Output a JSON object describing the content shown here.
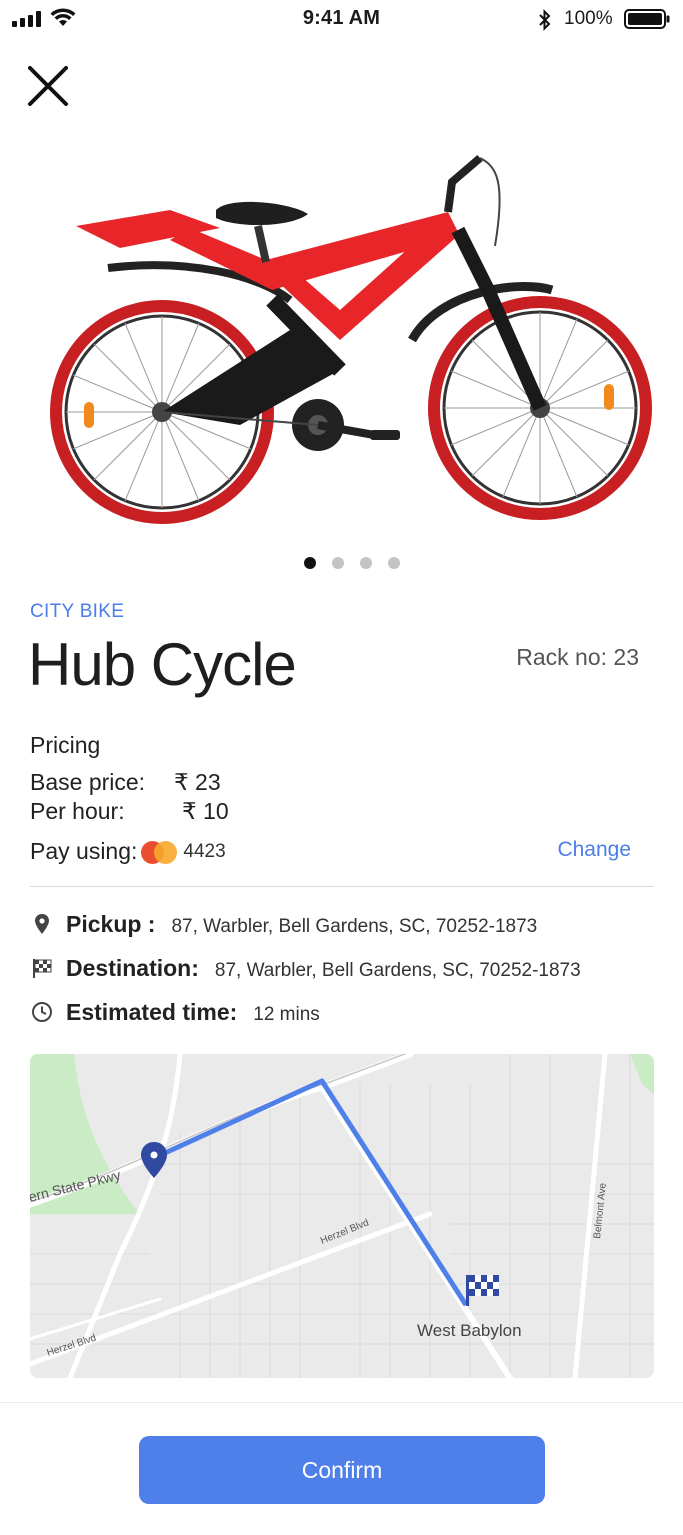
{
  "status_bar": {
    "time": "9:41 AM",
    "battery": "100%"
  },
  "gallery": {
    "active_index": 0,
    "count": 4
  },
  "bike": {
    "category": "CITY BIKE",
    "name": "Hub Cycle",
    "rack": "Rack no: 23"
  },
  "pricing": {
    "heading": "Pricing",
    "base_label": "Base price:",
    "base_value": "₹ 23",
    "hour_label": "Per hour:",
    "hour_value": "₹ 10",
    "pay_label": "Pay using:",
    "card_last4": "4423",
    "change_label": "Change"
  },
  "trip": {
    "pickup_label": "Pickup :",
    "pickup_value": "87, Warbler, Bell Gardens, SC, 70252-1873",
    "destination_label": "Destination:",
    "destination_value": "87, Warbler, Bell Gardens, SC, 70252-1873",
    "time_label": "Estimated time:",
    "time_value": "12 mins"
  },
  "map": {
    "labels": {
      "street1": "ern State Pkwy",
      "street2": "Herzel Blvd",
      "street3": "Herzel Blvd",
      "street4": "Belmont Ave",
      "place": "West Babylon"
    },
    "route_color": "#4f7fe8",
    "pin_color": "#2f4aa0"
  },
  "actions": {
    "confirm_label": "Confirm"
  },
  "colors": {
    "accent": "#4a7ee8",
    "button": "#4f7fe8",
    "bike_red": "#e8262a"
  }
}
